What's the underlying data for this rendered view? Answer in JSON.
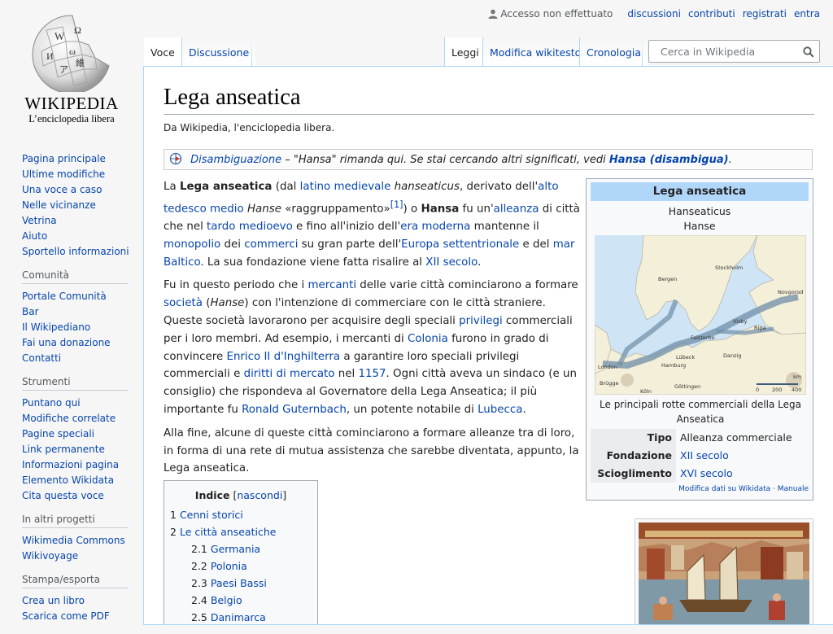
{
  "personal": {
    "not_logged_in": "Accesso non effettuato",
    "links": [
      "discussioni",
      "contributi",
      "registrati",
      "entra"
    ]
  },
  "logo": {
    "wordmark": "WIKIPEDIA",
    "tagline": "L’enciclopedia libera",
    "icon": "wikipedia-globe"
  },
  "tabs": {
    "left": [
      "Voce",
      "Discussione"
    ],
    "right": [
      "Leggi",
      "Modifica wikitesto",
      "Cronologia"
    ]
  },
  "search": {
    "placeholder": "Cerca in Wikipedia",
    "icon": "search-icon"
  },
  "sidebar": {
    "navigation": [
      "Pagina principale",
      "Ultime modifiche",
      "Una voce a caso",
      "Nelle vicinanze",
      "Vetrina",
      "Aiuto",
      "Sportello informazioni"
    ],
    "community": {
      "title": "Comunità",
      "items": [
        "Portale Comunità",
        "Bar",
        "Il Wikipediano",
        "Fai una donazione",
        "Contatti"
      ]
    },
    "tools": {
      "title": "Strumenti",
      "items": [
        "Puntano qui",
        "Modifiche correlate",
        "Pagine speciali",
        "Link permanente",
        "Informazioni pagina",
        "Elemento Wikidata",
        "Cita questa voce"
      ]
    },
    "other_projects": {
      "title": "In altri progetti",
      "items": [
        "Wikimedia Commons",
        "Wikivoyage"
      ]
    },
    "print": {
      "title": "Stampa/esporta",
      "items": [
        "Crea un libro",
        "Scarica come PDF"
      ]
    }
  },
  "article": {
    "title": "Lega anseatica",
    "site_sub": "Da Wikipedia, l'enciclopedia libera.",
    "hatnote": {
      "link": "Disambiguazione",
      "text": " – \"Hansa\" rimanda qui. Se stai cercando altri significati, vedi ",
      "target": "Hansa (disambigua)",
      "end": "."
    },
    "p1": [
      {
        "t": "La "
      },
      {
        "t": "Lega anseatica",
        "b": true
      },
      {
        "t": " (dal "
      },
      {
        "t": "latino medievale",
        "a": true
      },
      {
        "t": " "
      },
      {
        "t": "hanseaticus",
        "i": true
      },
      {
        "t": ", derivato dell'"
      },
      {
        "t": "alto tedesco medio",
        "a": true
      },
      {
        "t": " "
      },
      {
        "t": "Hanse",
        "i": true
      },
      {
        "t": " «raggruppamento»"
      },
      {
        "t": "[1]",
        "sup": true
      },
      {
        "t": ") o "
      },
      {
        "t": "Hansa",
        "b": true
      },
      {
        "t": " fu un'"
      },
      {
        "t": "alleanza",
        "a": true
      },
      {
        "t": " di città che nel "
      },
      {
        "t": "tardo medioevo",
        "a": true
      },
      {
        "t": " e fino all'inizio dell'"
      },
      {
        "t": "era moderna",
        "a": true
      },
      {
        "t": " mantenne il "
      },
      {
        "t": "monopolio",
        "a": true
      },
      {
        "t": " dei "
      },
      {
        "t": "commerci",
        "a": true
      },
      {
        "t": " su gran parte dell'"
      },
      {
        "t": "Europa settentrionale",
        "a": true
      },
      {
        "t": " e del "
      },
      {
        "t": "mar Baltico",
        "a": true
      },
      {
        "t": ". La sua fondazione viene fatta risalire al "
      },
      {
        "t": "XII secolo",
        "a": true
      },
      {
        "t": "."
      }
    ],
    "p2": [
      {
        "t": "Fu in questo periodo che i "
      },
      {
        "t": "mercanti",
        "a": true
      },
      {
        "t": " delle varie città cominciarono a formare "
      },
      {
        "t": "società",
        "a": true
      },
      {
        "t": " ("
      },
      {
        "t": "Hanse",
        "i": true
      },
      {
        "t": ") con l'intenzione di commerciare con le città straniere. Queste società lavorarono per acquisire degli speciali "
      },
      {
        "t": "privilegi",
        "a": true
      },
      {
        "t": " commerciali per i loro membri. Ad esempio, i mercanti di "
      },
      {
        "t": "Colonia",
        "a": true
      },
      {
        "t": " furono in grado di convincere "
      },
      {
        "t": "Enrico II d'Inghilterra",
        "a": true
      },
      {
        "t": " a garantire loro speciali privilegi commerciali e "
      },
      {
        "t": "diritti di mercato",
        "a": true
      },
      {
        "t": " nel "
      },
      {
        "t": "1157",
        "a": true
      },
      {
        "t": ". Ogni città aveva un sindaco (e un consiglio) che rispondeva al Governatore della Lega Anseatica; il più importante fu "
      },
      {
        "t": "Ronald Guternbach",
        "a": true
      },
      {
        "t": ", un potente notabile di "
      },
      {
        "t": "Lubecca",
        "a": true
      },
      {
        "t": "."
      }
    ],
    "p3": [
      {
        "t": "Alla fine, alcune di queste città cominciarono a formare alleanze tra di loro, in forma di una rete di mutua assistenza che sarebbe diventata, appunto, la Lega anseatica."
      }
    ]
  },
  "infobox": {
    "title": "Lega anseatica",
    "subtitle1": "Hanseaticus",
    "subtitle2": "Hanse",
    "map_labels": [
      "Bergen",
      "Stockholm",
      "Novgorod",
      "Visby",
      "Riga",
      "Falsterbo",
      "Danzig",
      "Lübeck",
      "Hamburg",
      "London",
      "Brügge",
      "Köln",
      "Göttingen"
    ],
    "scale": {
      "unit": "km",
      "ticks": [
        "0",
        "200",
        "400"
      ]
    },
    "caption": "Le principali rotte commerciali della Lega Anseatica",
    "rows": [
      {
        "label": "Tipo",
        "value": "Alleanza commerciale",
        "link": false
      },
      {
        "label": "Fondazione",
        "value": "XII secolo",
        "link": true
      },
      {
        "label": "Scioglimento",
        "value": "XVI secolo",
        "link": true
      }
    ],
    "footer_link": "Modifica dati su Wikidata",
    "footer_sep": " · ",
    "footer_manual": "Manuale"
  },
  "toc": {
    "title": "Indice",
    "toggle_open": "[",
    "toggle": "nascondi",
    "toggle_close": "]",
    "items": [
      {
        "num": "1",
        "label": "Cenni storici",
        "level": 1
      },
      {
        "num": "2",
        "label": "Le città anseatiche",
        "level": 1
      },
      {
        "num": "2.1",
        "label": "Germania",
        "level": 2
      },
      {
        "num": "2.2",
        "label": "Polonia",
        "level": 2
      },
      {
        "num": "2.3",
        "label": "Paesi Bassi",
        "level": 2
      },
      {
        "num": "2.4",
        "label": "Belgio",
        "level": 2
      },
      {
        "num": "2.5",
        "label": "Danimarca",
        "level": 2
      }
    ]
  },
  "colors": {
    "link": "#0645ad",
    "infobox_header": "#b0d6f9",
    "tab_border": "#a7d7f9",
    "sea": "#cfe5f5",
    "land": "#f4efd9",
    "route": "#6f8ea8"
  }
}
